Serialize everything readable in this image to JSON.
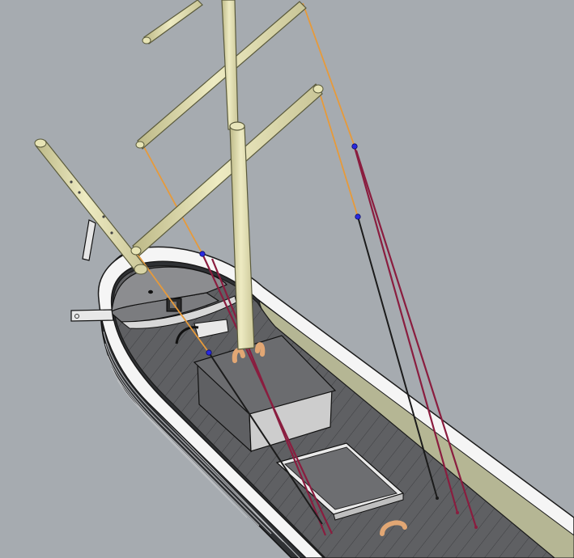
{
  "scene": {
    "colors": {
      "background": "#a6abb0",
      "spar": "#e7e4b5",
      "spar_outline": "#5a5a3c",
      "hull_dark": "#2e3033",
      "hull_light": "#f4f4f4",
      "deck": "#5e5f62",
      "cabin_top": "#6a6b6e",
      "cabin_side": "#c9c9c9",
      "rope_orange": "#e79a3a",
      "rope_crimson": "#8a1d3f",
      "rope_black": "#1b1b1b",
      "block_blue": "#2a2ae0",
      "fitting_copper": "#e2a774"
    },
    "icons": [
      "mast",
      "yard",
      "bowsprit",
      "rigging-line",
      "pulley-block",
      "hatch",
      "cabin"
    ]
  }
}
